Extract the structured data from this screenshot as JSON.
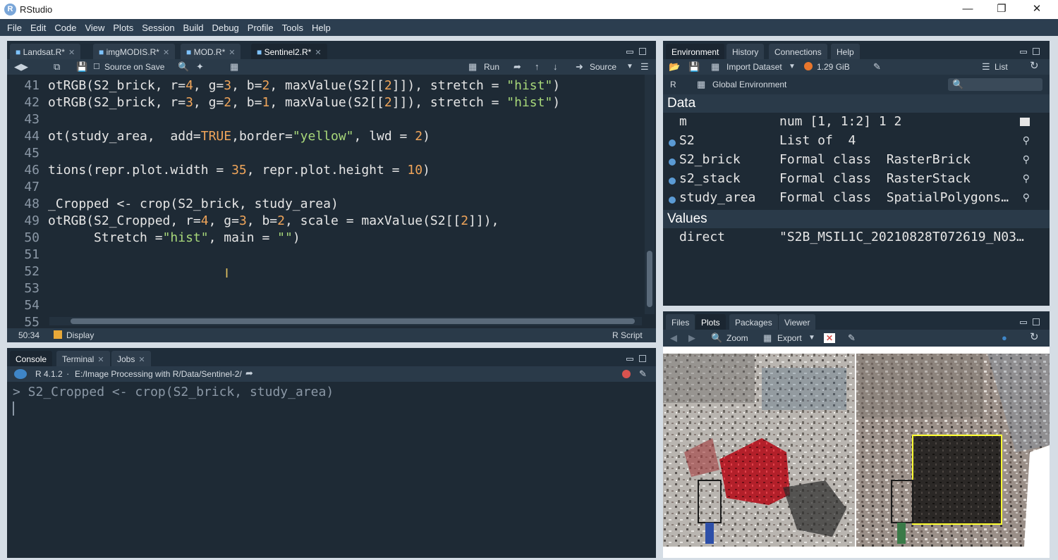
{
  "window": {
    "title": "RStudio",
    "logo": "R"
  },
  "menu": [
    "File",
    "Edit",
    "Code",
    "View",
    "Plots",
    "Session",
    "Build",
    "Debug",
    "Profile",
    "Tools",
    "Help"
  ],
  "editor": {
    "tabs": [
      {
        "label": "Landsat.R*"
      },
      {
        "label": "imgMODIS.R*"
      },
      {
        "label": "MOD.R*"
      },
      {
        "label": "Sentinel2.R*"
      }
    ],
    "toolbar": {
      "source_on_save": "Source on Save",
      "run": "Run",
      "source": "Source"
    },
    "lines": [
      {
        "n": "41",
        "text": "otRGB(S2_brick, r=4, g=3, b=2, maxValue(S2[[2]]), stretch = \"hist\")"
      },
      {
        "n": "42",
        "text": "otRGB(S2_brick, r=3, g=2, b=1, maxValue(S2[[2]]), stretch = \"hist\")"
      },
      {
        "n": "43",
        "text": ""
      },
      {
        "n": "44",
        "text": "ot(study_area,  add=TRUE,border=\"yellow\", lwd = 2)"
      },
      {
        "n": "45",
        "text": ""
      },
      {
        "n": "46",
        "text": "tions(repr.plot.width = 35, repr.plot.height = 10)"
      },
      {
        "n": "47",
        "text": ""
      },
      {
        "n": "48",
        "text": "_Cropped <- crop(S2_brick, study_area)"
      },
      {
        "n": "49",
        "text": "otRGB(S2_Cropped, r=4, g=3, b=2, scale = maxValue(S2[[2]]),"
      },
      {
        "n": "50",
        "text": "      Stretch =\"hist\", main = \"\")"
      },
      {
        "n": "51",
        "text": ""
      },
      {
        "n": "52",
        "text": ""
      },
      {
        "n": "53",
        "text": ""
      },
      {
        "n": "54",
        "text": ""
      },
      {
        "n": "55",
        "text": ""
      }
    ],
    "status": {
      "position": "50:34",
      "scope": "Display",
      "type": "R Script"
    }
  },
  "console": {
    "tabs": [
      "Console",
      "Terminal",
      "Jobs"
    ],
    "r_version": "R 4.1.2",
    "path": "E:/Image Processing with R/Data/Sentinel-2/",
    "command": "> S2_Cropped <- crop(S2_brick, study_area)"
  },
  "environment": {
    "tabs": [
      "Environment",
      "History",
      "Connections",
      "Help"
    ],
    "import_dataset": "Import Dataset",
    "memory": "1.29 GiB",
    "view_mode": "List",
    "language": "R",
    "scope": "Global Environment",
    "data_header": "Data",
    "values_header": "Values",
    "data": [
      {
        "name": "m",
        "value": "num [1, 1:2] 1 2",
        "dot": false
      },
      {
        "name": "S2",
        "value": "List of  4",
        "dot": true
      },
      {
        "name": "S2_brick",
        "value": "Formal class  RasterBrick",
        "dot": true
      },
      {
        "name": "s2_stack",
        "value": "Formal class  RasterStack",
        "dot": true
      },
      {
        "name": "study_area",
        "value": "Formal class  SpatialPolygons…",
        "dot": true
      }
    ],
    "values": [
      {
        "name": "direct",
        "value": "\"S2B_MSIL1C_20210828T072619_N03…"
      }
    ]
  },
  "files": {
    "tabs": [
      "Files",
      "Plots",
      "Packages",
      "Viewer"
    ],
    "zoom": "Zoom",
    "export": "Export"
  },
  "colors": {
    "menubar": "#2c3e50",
    "editor_bg": "#1e2a35",
    "polygon": "#ffff33",
    "highlight_red": "#c0242a"
  }
}
